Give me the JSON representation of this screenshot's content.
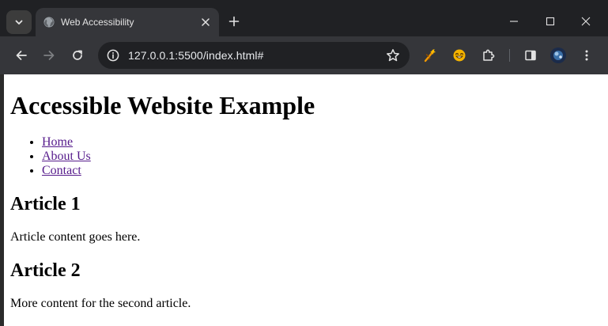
{
  "browser": {
    "tab": {
      "title": "Web Accessibility"
    },
    "omnibox": {
      "url": "127.0.0.1:5500/index.html#"
    }
  },
  "page": {
    "heading": "Accessible Website Example",
    "nav": [
      {
        "label": "Home"
      },
      {
        "label": "About Us"
      },
      {
        "label": "Contact"
      }
    ],
    "articles": [
      {
        "title": "Article 1",
        "content": "Article content goes here."
      },
      {
        "title": "Article 2",
        "content": "More content for the second article."
      }
    ]
  },
  "colors": {
    "frame": "#202124",
    "toolbar": "#35363a",
    "visited_link": "#551a8b"
  }
}
